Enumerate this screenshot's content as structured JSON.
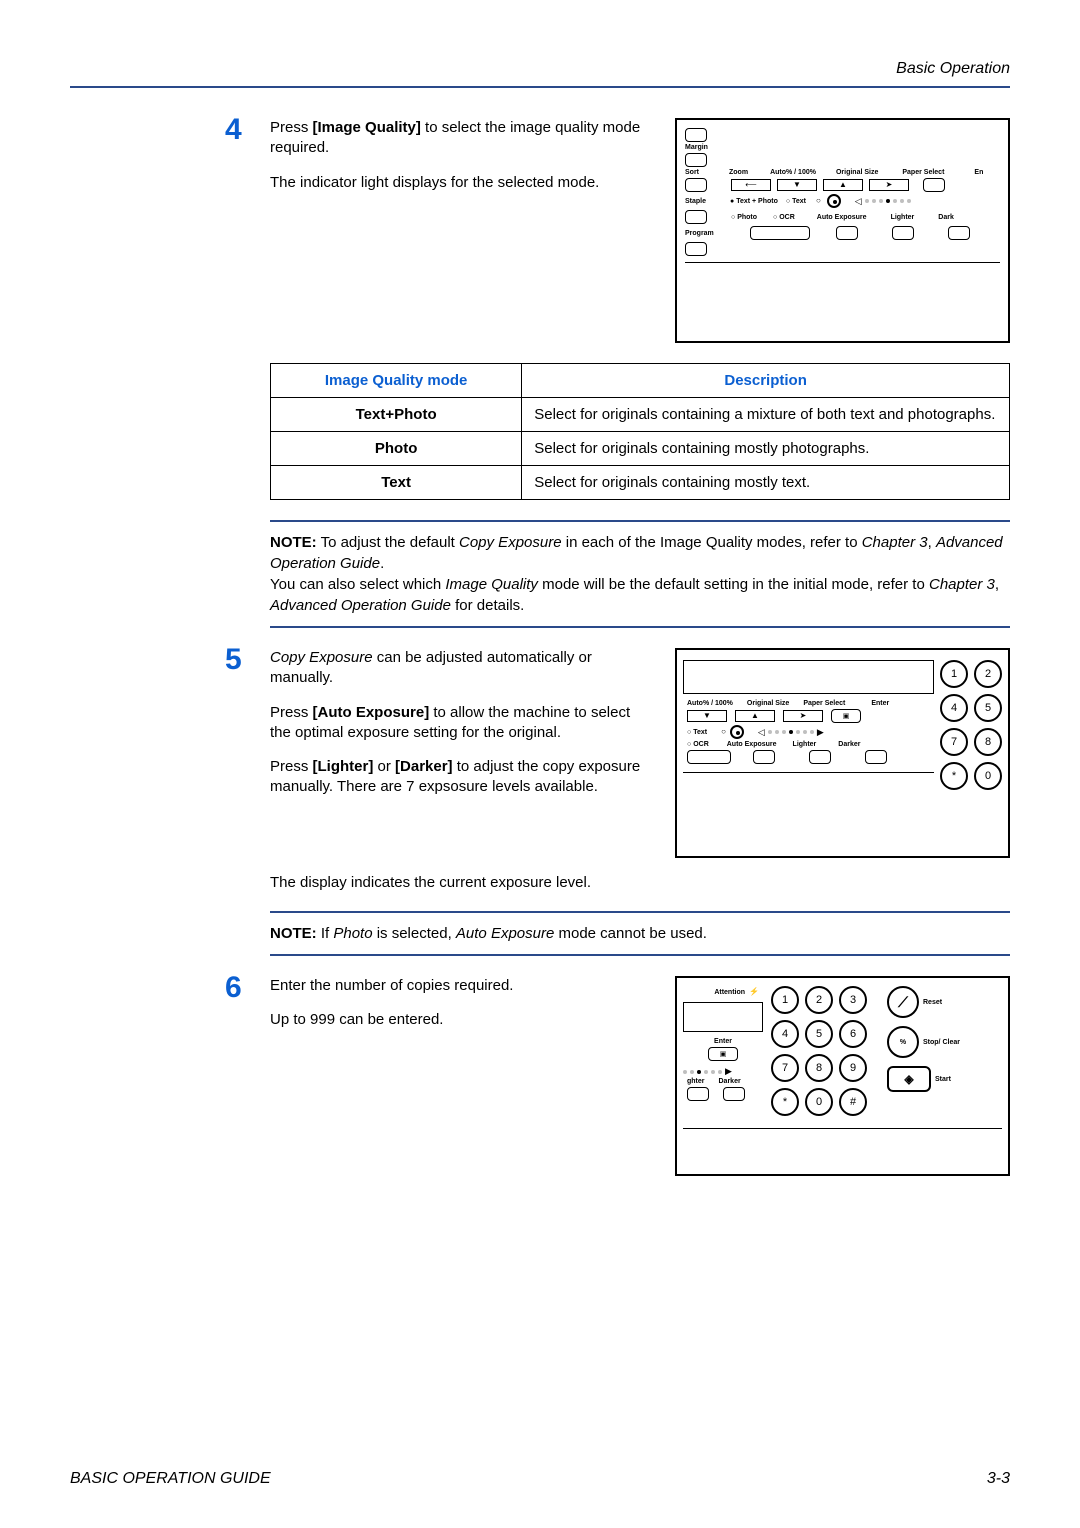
{
  "header": {
    "title": "Basic Operation"
  },
  "step4": {
    "number": "4",
    "para1_pre": "Press ",
    "para1_bold": "[Image Quality]",
    "para1_post": " to select the image quality mode required.",
    "para2": "The indicator light displays for the selected mode."
  },
  "panel1": {
    "labels": {
      "margin": "Margin",
      "sort": "Sort",
      "staple": "Staple",
      "program": "Program",
      "zoom": "Zoom",
      "auto100": "Auto% / 100%",
      "originalsize": "Original Size",
      "paperselect": "Paper Select",
      "en": "En",
      "textphoto": "Text + Photo",
      "text": "Text",
      "photo": "Photo",
      "ocr": "OCR",
      "autoexposure": "Auto Exposure",
      "lighter": "Lighter",
      "darker": "Dark"
    }
  },
  "table": {
    "header_mode": "Image Quality mode",
    "header_desc": "Description",
    "rows": [
      {
        "mode": "Text+Photo",
        "desc": "Select for originals containing a mixture of both text and photographs."
      },
      {
        "mode": "Photo",
        "desc": "Select for originals containing mostly photographs."
      },
      {
        "mode": "Text",
        "desc": "Select for originals containing mostly text."
      }
    ]
  },
  "note1": {
    "label": "NOTE:",
    "l1a": " To adjust the default ",
    "l1b_it": "Copy Exposure",
    "l1c": " in each of the Image Quality modes, refer to ",
    "l1d_it": "Chapter 3",
    "l1e": ", ",
    "l1f_it": "Advanced Operation Guide",
    "l1g": ".",
    "l2a": "You can also select which ",
    "l2b_it": "Image Quality",
    "l2c": " mode will be the default setting in the initial mode, refer to ",
    "l2d_it": "Chapter 3",
    "l2e": ", ",
    "l2f_it": "Advanced Operation Guide",
    "l2g": " for details."
  },
  "step5": {
    "number": "5",
    "p1a_it": "Copy Exposure",
    "p1b": " can be adjusted automatically or manually.",
    "p2a": "Press ",
    "p2b_bold": "[Auto Exposure]",
    "p2c": " to allow the machine to select the optimal exposure setting for the original.",
    "p3a": "Press ",
    "p3b_bold": "[Lighter]",
    "p3c": " or ",
    "p3d_bold": "[Darker]",
    "p3e": " to adjust the copy exposure manually.  There are 7 expsosure levels available.",
    "p4": "The display indicates the current exposure level."
  },
  "panel2": {
    "labels": {
      "auto100": "Auto% / 100%",
      "originalsize": "Original Size",
      "paperselect": "Paper Select",
      "enter": "Enter",
      "text": "Text",
      "ocr": "OCR",
      "autoexposure": "Auto Exposure",
      "lighter": "Lighter",
      "darker": "Darker",
      "k1": "1",
      "k2": "2",
      "k4": "4",
      "k5": "5",
      "k7": "7",
      "k8": "8",
      "kstar": "*",
      "k0": "0"
    }
  },
  "note2": {
    "label": "NOTE:",
    "a": " If ",
    "b_it": "Photo",
    "c": " is selected, ",
    "d_it": "Auto Exposure",
    "e": " mode cannot be used."
  },
  "step6": {
    "number": "6",
    "p1": "Enter the number of copies required.",
    "p2": "Up to 999 can be entered."
  },
  "panel3": {
    "labels": {
      "attention": "Attention",
      "enter": "Enter",
      "lighter": "ghter",
      "darker": "Darker",
      "reset": "Reset",
      "stopclear": "Stop/ Clear",
      "start": "Start",
      "k1": "1",
      "k2": "2",
      "k3": "3",
      "k4": "4",
      "k5": "5",
      "k6": "6",
      "k7": "7",
      "k8": "8",
      "k9": "9",
      "kstar": "*",
      "k0": "0",
      "khash": "#",
      "pct": "%"
    }
  },
  "footer": {
    "left": "BASIC OPERATION GUIDE",
    "right": "3-3"
  }
}
